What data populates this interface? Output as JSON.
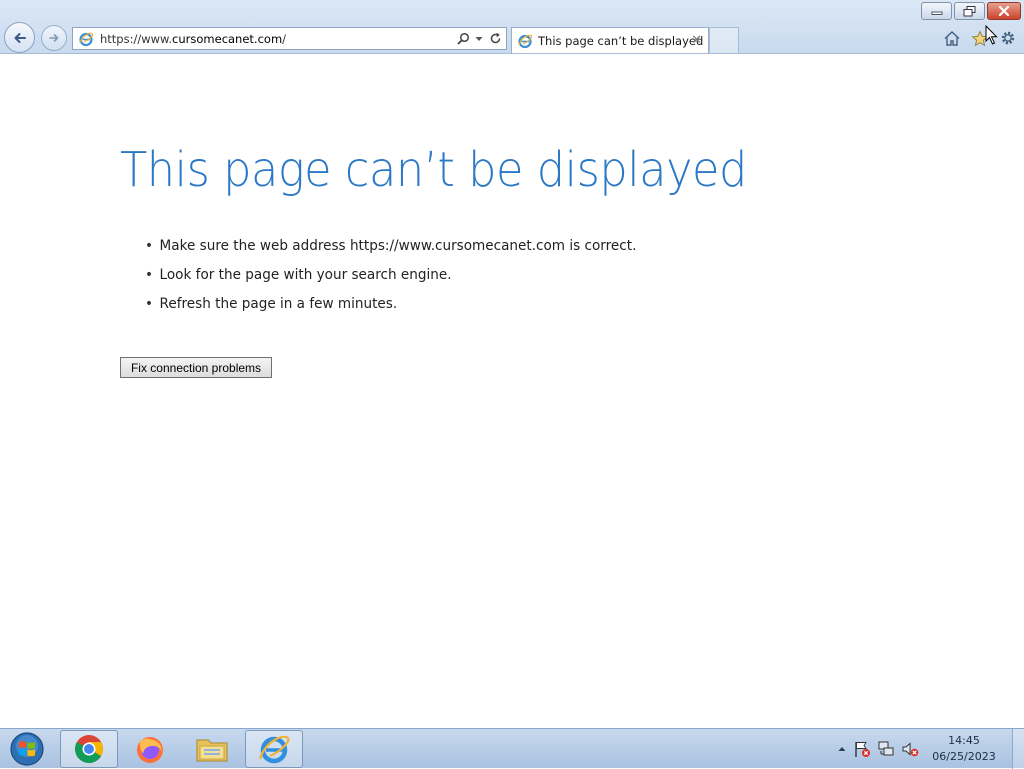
{
  "browser": {
    "address_bar": {
      "url_prefix": "https://www.",
      "url_domain": "cursomecanet.com",
      "url_suffix": "/"
    },
    "tab": {
      "title": "This page can’t be displayed",
      "close_glyph": "✕"
    },
    "icons": [
      "back-icon",
      "forward-icon",
      "ie-page-icon",
      "search-icon",
      "dropdown-icon",
      "refresh-icon",
      "home-icon",
      "favorites-icon",
      "tools-gear-icon"
    ],
    "window_controls": [
      "minimize",
      "restore",
      "close"
    ]
  },
  "page": {
    "title": "This page can’t be displayed",
    "suggestions": [
      "Make sure the web address https://www.cursomecanet.com is correct.",
      "Look for the page with your search engine.",
      "Refresh the page in a few minutes."
    ],
    "bullet": "•",
    "fix_button_label": "Fix connection problems"
  },
  "taskbar": {
    "pinned": [
      "chrome",
      "firefox",
      "file-explorer",
      "internet-explorer"
    ],
    "active": "internet-explorer",
    "clock": {
      "time": "14:45",
      "date": "06/25/2023"
    },
    "tray_icons": [
      "show-hidden-icons-arrow",
      "action-center-flag-icon",
      "network-icon",
      "volume-muted-icon"
    ]
  },
  "colors": {
    "title_blue": "#2b78c6",
    "chrome_bg": "#d2e1f2",
    "taskbar_bg": "#b8cde7",
    "close_red": "#c9432a"
  }
}
